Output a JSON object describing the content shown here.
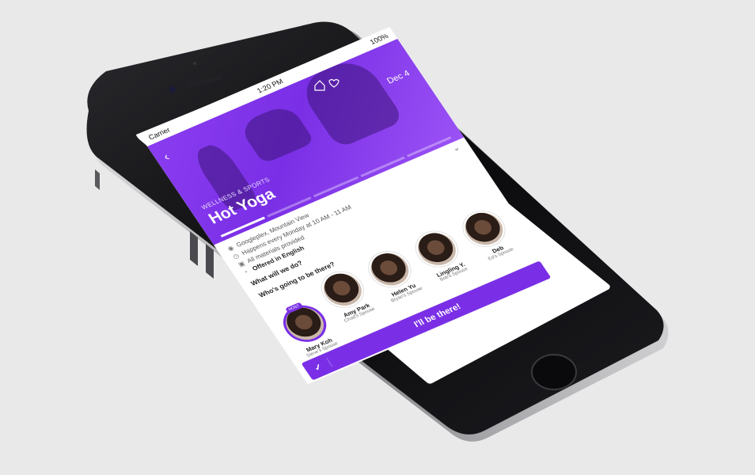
{
  "status": {
    "carrier": "Carrier",
    "time": "1:20 PM",
    "battery": "100%"
  },
  "hero": {
    "back_icon": "chevron-left-icon",
    "date": "Dec 4",
    "category": "WELLNESS & SPORTS",
    "title": "Hot Yoga",
    "header_icons": [
      "home-icon",
      "heart-icon"
    ]
  },
  "details": {
    "location": "Googleplex, Mountain View",
    "schedule": "Happens every Monday at 10 AM - 11 AM",
    "materials": "All materials provided",
    "language": "Offered in English",
    "what_heading": "What will we do?",
    "who_heading": "Who's going to be there?"
  },
  "people": [
    {
      "name": "Mary Koh",
      "sub": "Steve's Spouse",
      "host": true
    },
    {
      "name": "Amy Park",
      "sub": "Chad's Spouse",
      "host": false
    },
    {
      "name": "Helen Yu",
      "sub": "Bryan's Spouse",
      "host": false
    },
    {
      "name": "Lingling Y.",
      "sub": "Bob's Spouse",
      "host": false
    },
    {
      "name": "Deb",
      "sub": "Ed's Spouse",
      "host": false
    }
  ],
  "host_badge": "HOST",
  "cta": {
    "label": "I'll be there!",
    "check_icon": "check-icon"
  },
  "colors": {
    "accent": "#7a2fe6",
    "hero_start": "#8a3cf0",
    "hero_end": "#9b52f5",
    "phone": "#0d0d0f",
    "background": "#e9e9ea"
  }
}
